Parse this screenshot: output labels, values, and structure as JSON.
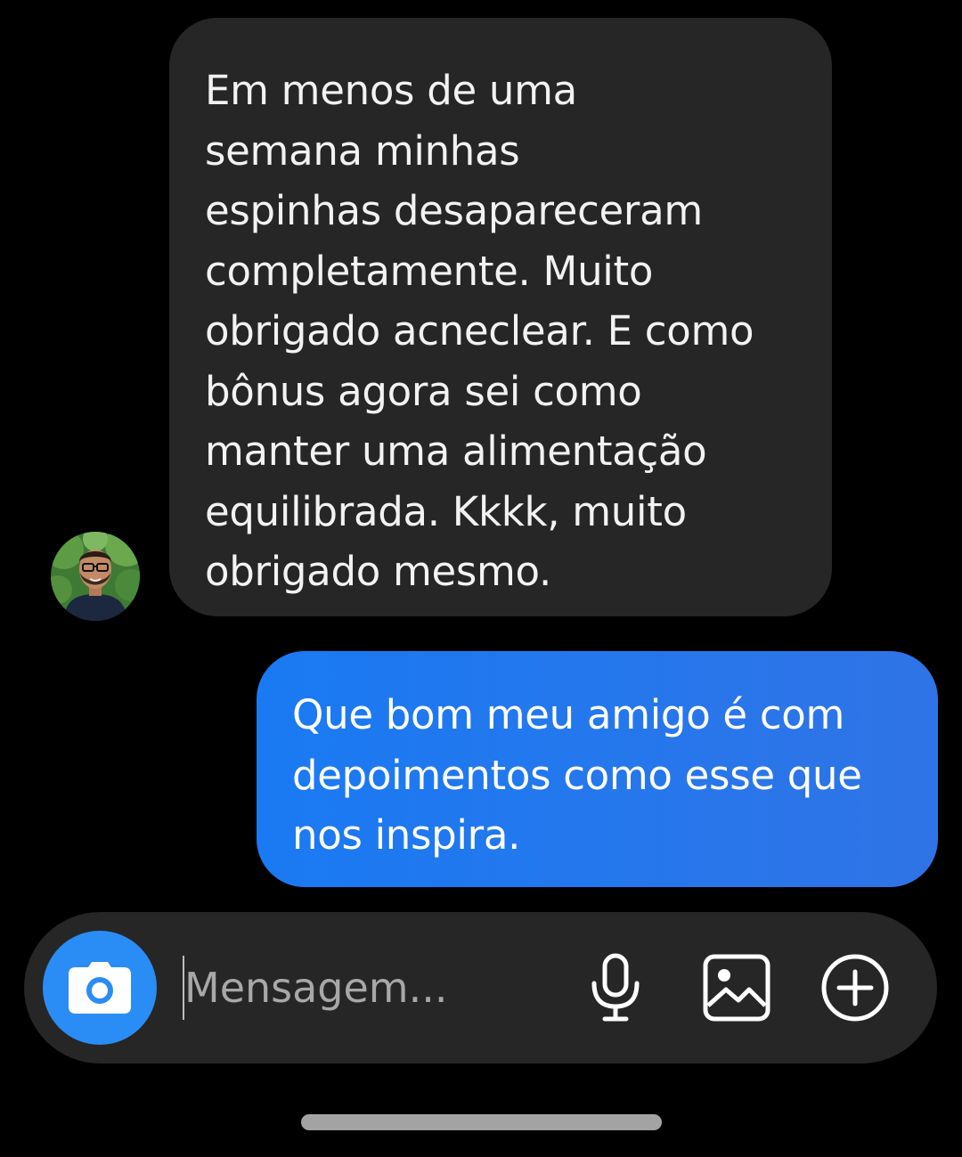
{
  "conversation": {
    "incoming_message": "Em menos de uma\nsemana minhas\nespinhas desapareceram\ncompletamente. Muito\nobrigado acneclear. E como\nbônus agora sei como\nmanter uma alimentação\nequilibrada. Kkkk, muito\nobrigado mesmo.",
    "outgoing_message": "Que bom meu amigo é com\ndepoimentos como esse que\nnos inspira."
  },
  "composer": {
    "placeholder": "Mensagem...",
    "camera_icon": "camera-icon",
    "mic_icon": "microphone-icon",
    "gallery_icon": "image-icon",
    "plus_icon": "plus-circle-icon"
  },
  "colors": {
    "background": "#000000",
    "incoming_bubble": "#262626",
    "outgoing_bubble": "#1a7af3",
    "accent": "#2a8df5"
  }
}
